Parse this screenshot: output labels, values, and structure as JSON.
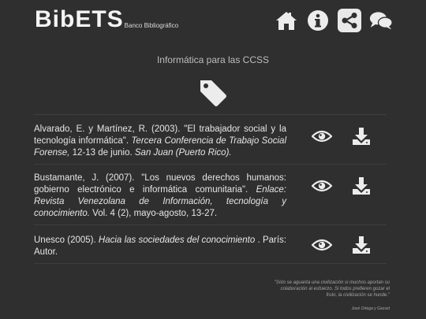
{
  "header": {
    "logo_text": "BibETS",
    "logo_sub": "Banco Bibliográfico",
    "nav": [
      {
        "name": "home-icon"
      },
      {
        "name": "info-icon"
      },
      {
        "name": "share-icon"
      },
      {
        "name": "chat-icon"
      }
    ]
  },
  "category": {
    "title": "Informática para las CCSS",
    "icon": "tag-icon"
  },
  "references": [
    {
      "parts": [
        {
          "text": "Alvarado, E. y Martínez, R. (2003). \"El trabajador social y la tecnología informática\". ",
          "italic": false
        },
        {
          "text": "Tercera Conferencia de Trabajo Social Forense,",
          "italic": true
        },
        {
          "text": " 12-13 de junio. ",
          "italic": false
        },
        {
          "text": "San Juan (Puerto Rico).",
          "italic": true
        }
      ]
    },
    {
      "parts": [
        {
          "text": "Bustamante, J. (2007). \"Los nuevos derechos humanos: gobierno electrónico e informática comunitaria\". ",
          "italic": false
        },
        {
          "text": "Enlace: Revista Venezolana de Información, tecnología y conocimiento.",
          "italic": true
        },
        {
          "text": " Vol. 4 (2), mayo-agosto, 13-27.",
          "italic": false
        }
      ]
    },
    {
      "parts": [
        {
          "text": "Unesco (2005). ",
          "italic": false
        },
        {
          "text": "Hacia las sociedades del conocimiento",
          "italic": true
        },
        {
          "text": " . París: Autor.",
          "italic": false
        }
      ]
    }
  ],
  "footer": {
    "quote": "\"Sólo se aguanta una civilización si muchos aportan su colaboración al esfuerzo. Si todos prefieren gozar el fruto, la civilización se hunde.\"",
    "author": "José Ortega y Gasset"
  },
  "colors": {
    "background": "#2f2f2f",
    "text": "#e6e6e6",
    "muted": "#bdbdbd",
    "icon": "#e9e9e9"
  }
}
